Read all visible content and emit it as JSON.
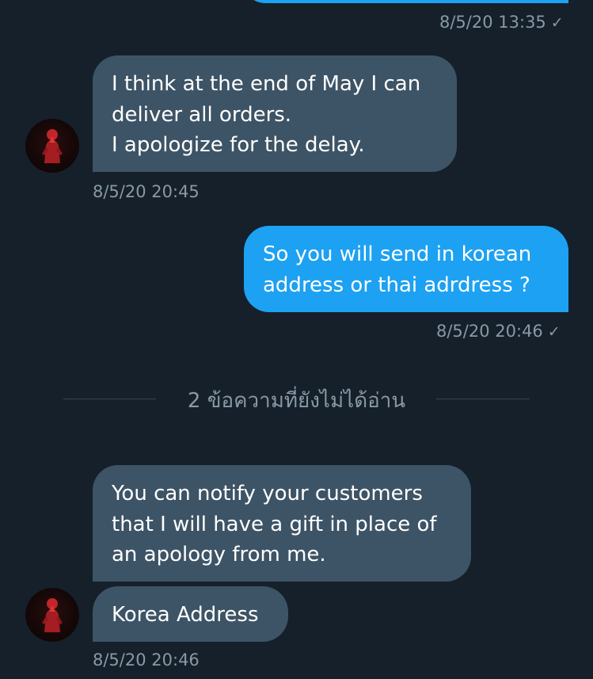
{
  "conversation": {
    "messages": [
      {
        "id": "prev",
        "timestamp": "8/5/20 13:35",
        "check": "✓"
      },
      {
        "id": "m1",
        "text": "I think at the end of May I can\ndeliver all orders.\nI apologize for the delay.",
        "timestamp": "8/5/20 20:45"
      },
      {
        "id": "m2",
        "text": "So you will send in korean\naddress or thai adrdress ?",
        "timestamp": "8/5/20 20:46",
        "check": "✓"
      },
      {
        "id": "m3",
        "text": "You can notify your customers\nthat I will have a gift in place of\nan apology from me."
      },
      {
        "id": "m4",
        "text": "Korea Address",
        "timestamp": "8/5/20 20:46"
      }
    ],
    "unread_divider": "2 ข้อความที่ยังไม่ได้อ่าน"
  },
  "colors": {
    "background": "#15202b",
    "incoming_bubble": "#3d5466",
    "outgoing_bubble": "#1da1f2",
    "timestamp_text": "#8899a6",
    "divider_line": "#38444d"
  }
}
